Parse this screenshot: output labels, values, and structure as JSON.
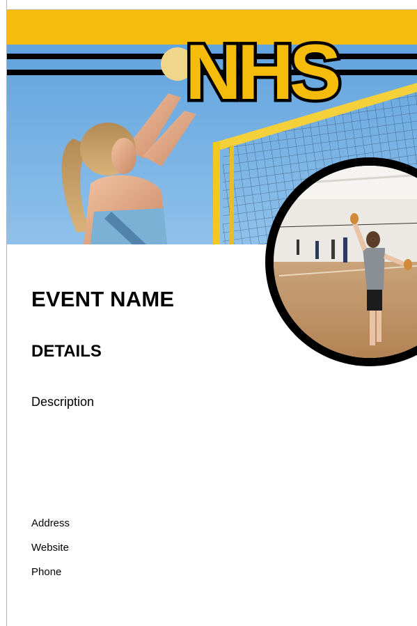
{
  "logo": {
    "text": "NHS"
  },
  "flyer": {
    "event_name": "EVENT NAME",
    "details_heading": "DETAILS",
    "description": "Description",
    "address": "Address",
    "website": "Website",
    "phone": "Phone"
  },
  "colors": {
    "accent_yellow": "#f6bc0b",
    "stripe_black": "#000000",
    "sky_blue": "#4f97d4"
  }
}
